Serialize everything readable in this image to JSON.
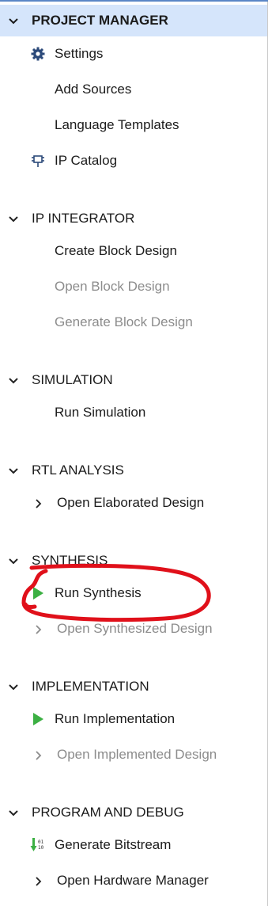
{
  "nav": {
    "sections": [
      {
        "title": "PROJECT MANAGER",
        "items": [
          {
            "label": "Settings",
            "icon": "gear-icon"
          },
          {
            "label": "Add Sources"
          },
          {
            "label": "Language Templates"
          },
          {
            "label": "IP Catalog",
            "icon": "ip-plug-icon"
          }
        ]
      },
      {
        "title": "IP INTEGRATOR",
        "items": [
          {
            "label": "Create Block Design"
          },
          {
            "label": "Open Block Design",
            "disabled": true
          },
          {
            "label": "Generate Block Design",
            "disabled": true
          }
        ]
      },
      {
        "title": "SIMULATION",
        "items": [
          {
            "label": "Run Simulation"
          }
        ]
      },
      {
        "title": "RTL ANALYSIS",
        "items": [
          {
            "label": "Open Elaborated Design",
            "expandable": true
          }
        ]
      },
      {
        "title": "SYNTHESIS",
        "items": [
          {
            "label": "Run Synthesis",
            "icon": "play-icon"
          },
          {
            "label": "Open Synthesized Design",
            "expandable": true,
            "disabled": true
          }
        ]
      },
      {
        "title": "IMPLEMENTATION",
        "items": [
          {
            "label": "Run Implementation",
            "icon": "play-icon"
          },
          {
            "label": "Open Implemented Design",
            "expandable": true,
            "disabled": true
          }
        ]
      },
      {
        "title": "PROGRAM AND DEBUG",
        "items": [
          {
            "label": "Generate Bitstream",
            "icon": "bitstream-icon"
          },
          {
            "label": "Open Hardware Manager",
            "expandable": true
          }
        ]
      }
    ]
  },
  "colors": {
    "active_bg": "#d5e5fb",
    "play_green": "#3cb043",
    "annotation_red": "#e0101a",
    "disabled_text": "#8c8c8c"
  }
}
